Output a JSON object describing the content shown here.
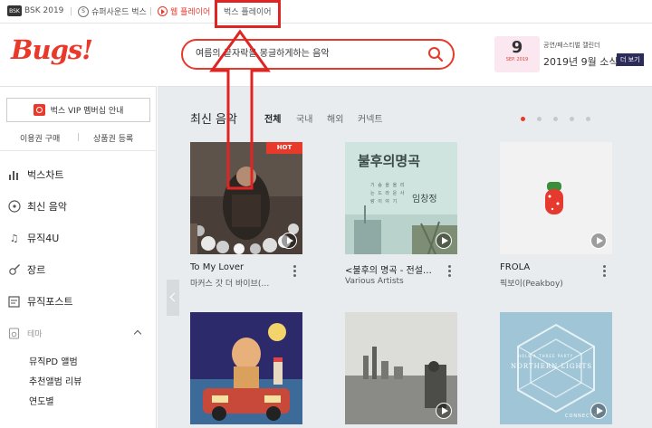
{
  "topbar": {
    "bsk": "BSK 2019",
    "super_sound": "슈퍼사운드 벅스",
    "web_player": "웹 플레이어",
    "bugs_player": "벅스 플레이어"
  },
  "header": {
    "logo": "Bugs!",
    "search_query": "여름의 끝자락을 몽글하게하는 음악",
    "calendar": {
      "day": "9",
      "month": "SEP. 2019",
      "subtitle": "공연/페스티벌 캘린더",
      "title": "2019년 9월 소식",
      "more": "더 보기"
    }
  },
  "sidebar": {
    "vip": "벅스 VIP 멤버십 안내",
    "links": [
      "이용권 구매",
      "상품권 등록"
    ],
    "menu": [
      {
        "label": "벅스차트",
        "icon": "chart-icon"
      },
      {
        "label": "최신 음악",
        "icon": "disc-icon"
      },
      {
        "label": "뮤직4U",
        "icon": "music-note-icon"
      },
      {
        "label": "장르",
        "icon": "guitar-icon"
      },
      {
        "label": "뮤직포스트",
        "icon": "post-icon"
      }
    ],
    "theme": "테마",
    "theme_items": [
      "뮤직PD 앨범",
      "추천앨범 리뷰",
      "연도별"
    ]
  },
  "main": {
    "title": "최신 음악",
    "tabs": [
      "전체",
      "국내",
      "해외",
      "커넥트"
    ],
    "active_tab": 0,
    "hot_badge": "HOT",
    "albums": [
      {
        "title": "To My Lover",
        "artist": "마커스 갓 더 바이브(…",
        "hot": true
      },
      {
        "title": "<불후의 명곡 - 전설…",
        "artist": "Various Artists",
        "hot": false
      },
      {
        "title": "FROLA",
        "artist": "픽보이(Peakboy)",
        "hot": false
      },
      {
        "title": "",
        "artist": "",
        "hot": false
      },
      {
        "title": "",
        "artist": "",
        "hot": false
      },
      {
        "title": "",
        "artist": "",
        "hot": false
      }
    ],
    "cover_texts": {
      "bulhu": "불후의명곡",
      "bulhu_sub": "기 슴 을 올 리 는 드 라 운 사 랑 이 야 기",
      "bulhu_name": "임창정",
      "northern": "NORTHERN LIGHTS",
      "northern_top": "HOLE A THREE PARTY",
      "connects": "CONNECTS"
    }
  },
  "colors": {
    "accent": "#e8392b",
    "main_bg": "#e9ecef",
    "annotation": "#e02424"
  }
}
